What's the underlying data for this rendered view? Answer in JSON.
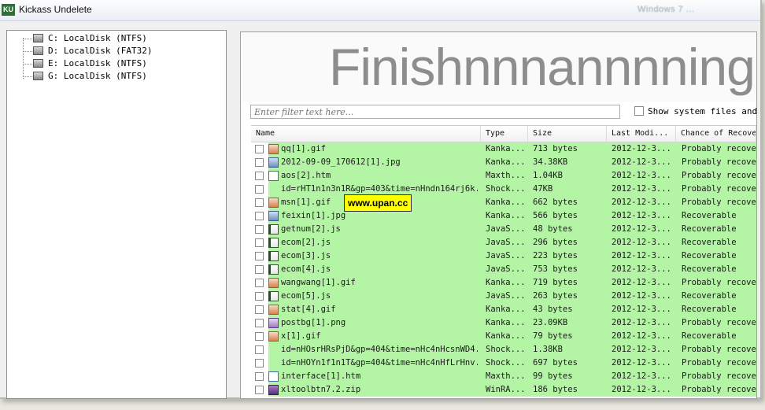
{
  "window": {
    "icon_text": "KU",
    "title": "Kickass Undelete",
    "title_blur": "Windows 7 ..."
  },
  "tree": {
    "drives": [
      {
        "label": "C: LocalDisk (NTFS)"
      },
      {
        "label": "D: LocalDisk (FAT32)"
      },
      {
        "label": "E: LocalDisk (NTFS)"
      },
      {
        "label": "G: LocalDisk (NTFS)"
      }
    ]
  },
  "banner": {
    "text": "Finishnnnannnning!"
  },
  "filter": {
    "placeholder": "Enter filter text here..."
  },
  "system_files": {
    "label": "Show system files and"
  },
  "columns": {
    "name": "Name",
    "type": "Type",
    "size": "Size",
    "date": "Last Modi...",
    "chance": "Chance of Recove"
  },
  "files": [
    {
      "name": "qq[1].gif",
      "type": "Kanka...",
      "size": "713 bytes",
      "date": "2012-12-3...",
      "chance": "Probably recove",
      "green": true,
      "icon": "gif-icon"
    },
    {
      "name": "2012-09-09_170612[1].jpg",
      "type": "Kanka...",
      "size": "34.38KB",
      "date": "2012-12-3...",
      "chance": "Probably recove",
      "green": true,
      "icon": "jpg-icon"
    },
    {
      "name": "aos[2].htm",
      "type": "Maxth...",
      "size": "1.04KB",
      "date": "2012-12-3...",
      "chance": "Probably recove",
      "green": true,
      "icon": "htm-icon"
    },
    {
      "name": "id=rHT1n1n3n1R&gp=403&time=nHndn164rj6k...",
      "type": "Shock...",
      "size": "47KB",
      "date": "2012-12-3...",
      "chance": "Probably recove",
      "green": true,
      "icon": "file-icon"
    },
    {
      "name": "msn[1].gif",
      "type": "Kanka...",
      "size": "662 bytes",
      "date": "2012-12-3...",
      "chance": "Probably recove",
      "green": true,
      "icon": "gif-icon"
    },
    {
      "name": "feixin[1].jpg",
      "type": "Kanka...",
      "size": "566 bytes",
      "date": "2012-12-3...",
      "chance": "Recoverable",
      "green": true,
      "icon": "jpg-icon"
    },
    {
      "name": "getnum[2].js",
      "type": "JavaS...",
      "size": "48 bytes",
      "date": "2012-12-3...",
      "chance": "Recoverable",
      "green": true,
      "icon": "js-icon"
    },
    {
      "name": "ecom[2].js",
      "type": "JavaS...",
      "size": "296 bytes",
      "date": "2012-12-3...",
      "chance": "Recoverable",
      "green": true,
      "icon": "js-icon"
    },
    {
      "name": "ecom[3].js",
      "type": "JavaS...",
      "size": "223 bytes",
      "date": "2012-12-3...",
      "chance": "Recoverable",
      "green": true,
      "icon": "js-icon"
    },
    {
      "name": "ecom[4].js",
      "type": "JavaS...",
      "size": "753 bytes",
      "date": "2012-12-3...",
      "chance": "Recoverable",
      "green": true,
      "icon": "js-icon"
    },
    {
      "name": "wangwang[1].gif",
      "type": "Kanka...",
      "size": "719 bytes",
      "date": "2012-12-3...",
      "chance": "Probably recove",
      "green": true,
      "icon": "gif-icon"
    },
    {
      "name": "ecom[5].js",
      "type": "JavaS...",
      "size": "263 bytes",
      "date": "2012-12-3...",
      "chance": "Recoverable",
      "green": true,
      "icon": "js-icon"
    },
    {
      "name": "stat[4].gif",
      "type": "Kanka...",
      "size": "43 bytes",
      "date": "2012-12-3...",
      "chance": "Recoverable",
      "green": true,
      "icon": "gif-icon"
    },
    {
      "name": "postbg[1].png",
      "type": "Kanka...",
      "size": "23.09KB",
      "date": "2012-12-3...",
      "chance": "Probably recove",
      "green": true,
      "icon": "png-icon"
    },
    {
      "name": "x[1].gif",
      "type": "Kanka...",
      "size": "79 bytes",
      "date": "2012-12-3...",
      "chance": "Recoverable",
      "green": true,
      "icon": "gif-icon"
    },
    {
      "name": "id=nHOsrHRsPjD&gp=404&time=nHc4nHcsnWD4...",
      "type": "Shock...",
      "size": "1.38KB",
      "date": "2012-12-3...",
      "chance": "Probably recove",
      "green": true,
      "icon": "file-icon"
    },
    {
      "name": "id=nHOYn1f1n1T&gp=404&time=nHc4nHfLrHnv...",
      "type": "Shock...",
      "size": "697 bytes",
      "date": "2012-12-3...",
      "chance": "Probably recove",
      "green": true,
      "icon": "file-icon"
    },
    {
      "name": "interface[1].htm",
      "type": "Maxth...",
      "size": "99 bytes",
      "date": "2012-12-3...",
      "chance": "Probably recove",
      "green": true,
      "icon": "htm-icon"
    },
    {
      "name": "xltoolbtn7.2.zip",
      "type": "WinRA...",
      "size": "186 bytes",
      "date": "2012-12-3...",
      "chance": "Probably recove",
      "green": true,
      "icon": "zip-icon"
    }
  ],
  "watermark": "www.upan.cc",
  "colors": {
    "recoverable_bg": "#b4f5a5",
    "banner_text": "#8d8d8d"
  }
}
